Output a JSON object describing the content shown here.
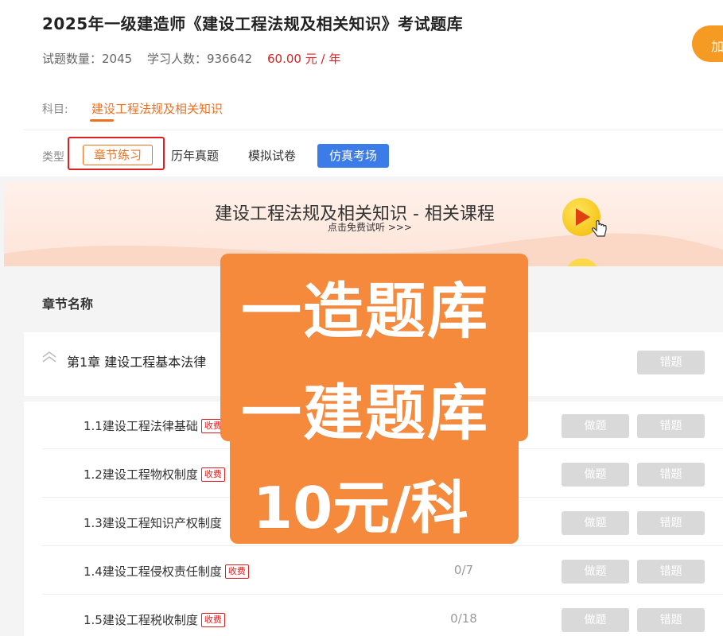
{
  "course": {
    "title": "2025年一级建造师《建设工程法规及相关知识》考试题库",
    "question_count_label": "试题数量：2045",
    "learner_count_label": "学习人数：936642",
    "price_label": "60.00 元 / 年",
    "buy_label": "加"
  },
  "subject": {
    "label": "科目:",
    "value": "建设工程法规及相关知识"
  },
  "types": {
    "label": "类型",
    "chapter": "章节练习",
    "past": "历年真题",
    "mock": "模拟试卷",
    "sim": "仿真考场"
  },
  "banner": {
    "title": "建设工程法规及相关知识 - 相关课程",
    "subtitle": "点击免费试听 >>>"
  },
  "list": {
    "header": "章节名称",
    "chapter": {
      "name": "第1章  建设工程基本法律",
      "wrong_label": "错题"
    },
    "sections": [
      {
        "name": "1.1建设工程法律基础",
        "tag": "收费",
        "progress": "",
        "do": "做题",
        "wrong": "错题"
      },
      {
        "name": "1.2建设工程物权制度",
        "tag": "收费",
        "progress": "",
        "do": "做题",
        "wrong": "错题"
      },
      {
        "name": "1.3建设工程知识产权制度",
        "tag": "",
        "progress": "",
        "do": "做题",
        "wrong": "错题"
      },
      {
        "name": "1.4建设工程侵权责任制度",
        "tag": "收费",
        "progress": "0/7",
        "do": "做题",
        "wrong": "错题"
      },
      {
        "name": "1.5建设工程税收制度",
        "tag": "收费",
        "progress": "0/18",
        "do": "做题",
        "wrong": "错题"
      }
    ]
  },
  "promo": {
    "line1": "一造题库",
    "line2": "一建题库",
    "line3": "10元/科"
  },
  "colors": {
    "accent": "#f07020",
    "price": "#e02020",
    "sim_button": "#3b7ce8",
    "promo": "#f58a3c"
  }
}
